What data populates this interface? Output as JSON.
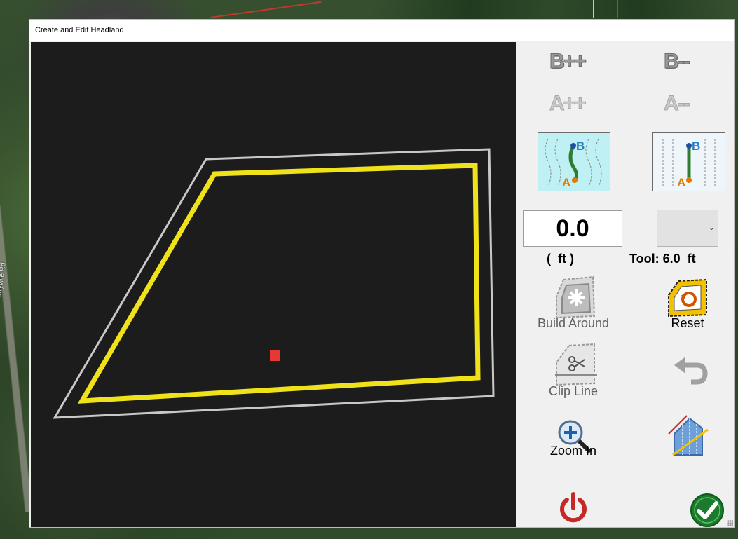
{
  "window": {
    "title": "Create and Edit Headland"
  },
  "background": {
    "road_label": "Perryville Rd"
  },
  "toolbar": {
    "b_plus": "B++",
    "b_minus": "B--",
    "a_plus": "A++",
    "a_minus": "A--",
    "curve_ab": {
      "a": "A",
      "b": "B"
    },
    "straight_ab": {
      "a": "A",
      "b": "B"
    }
  },
  "offset": {
    "value": "0.0",
    "unit_label": "(  ft )",
    "tool_label": "Tool: 6.0  ft"
  },
  "actions": {
    "build_around": "Build Around",
    "reset": "Reset",
    "clip_line": "Clip Line",
    "zoom_in": "Zoom In"
  },
  "colors": {
    "canvas_bg": "#1c1c1c",
    "boundary": "#c8c8c8",
    "headland": "#f0e21a",
    "marker": "#e53935",
    "power": "#c62828",
    "ok": "#1b7a2b"
  },
  "icons": [
    "curve-ab-icon",
    "straight-ab-icon",
    "build-around-icon",
    "reset-icon",
    "clip-line-icon",
    "undo-icon",
    "zoom-in-icon",
    "headland-lines-icon",
    "power-icon",
    "ok-check-icon",
    "chevron-down-icon"
  ]
}
